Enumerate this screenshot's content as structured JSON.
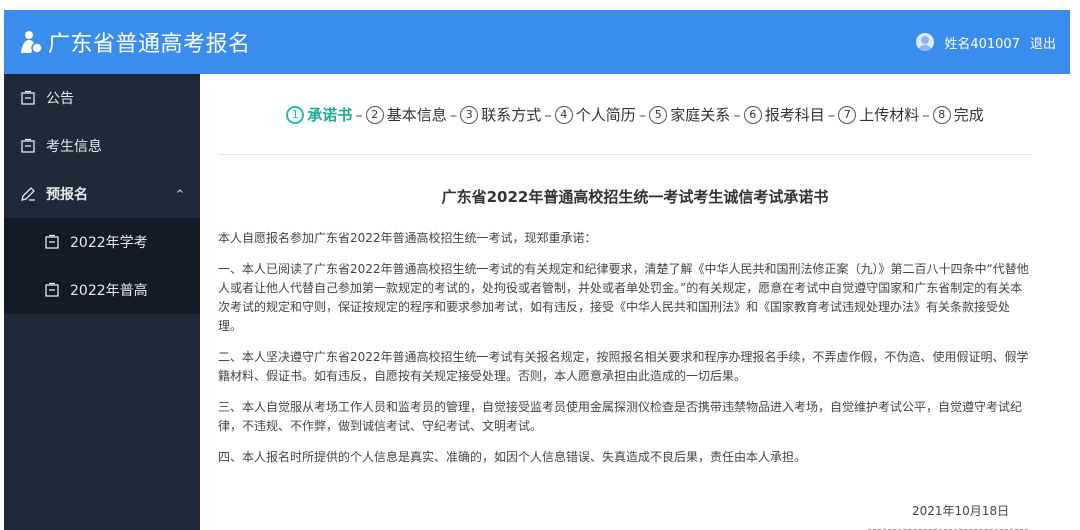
{
  "header": {
    "app_title": "广东省普通高考报名",
    "username": "姓名401007",
    "logout_label": "退出",
    "bar_color": "#3b8ded"
  },
  "sidebar": {
    "items": [
      {
        "label": "公告",
        "icon": "document-icon"
      },
      {
        "label": "考生信息",
        "icon": "document-icon"
      },
      {
        "label": "预报名",
        "icon": "edit-icon",
        "expanded": true
      }
    ],
    "subitems": [
      {
        "label": "2022年学考",
        "icon": "document-icon"
      },
      {
        "label": "2022年普高",
        "icon": "document-icon"
      }
    ],
    "background": "#1e2a38",
    "submenu_background": "#121b26"
  },
  "stepper": {
    "steps": [
      {
        "num": "1",
        "label": "承诺书",
        "active": true
      },
      {
        "num": "2",
        "label": "基本信息"
      },
      {
        "num": "3",
        "label": "联系方式"
      },
      {
        "num": "4",
        "label": "个人简历"
      },
      {
        "num": "5",
        "label": "家庭关系"
      },
      {
        "num": "6",
        "label": "报考科目"
      },
      {
        "num": "7",
        "label": "上传材料"
      },
      {
        "num": "8",
        "label": "完成"
      }
    ],
    "separator": "–",
    "active_color": "#20c0b0"
  },
  "document": {
    "title": "广东省2022年普通高校招生统一考试考生诚信考试承诺书",
    "intro": "本人自愿报名参加广东省2022年普通高校招生统一考试，现郑重承诺：",
    "paragraphs": [
      "一、本人已阅读了广东省2022年普通高校招生统一考试的有关规定和纪律要求，清楚了解《中华人民共和国刑法修正案（九）》第二百八十四条中“代替他人或者让他人代替自己参加第一款规定的考试的，处拘役或者管制，并处或者单处罚金。”的有关规定，愿意在考试中自觉遵守国家和广东省制定的有关本次考试的规定和守则，保证按规定的程序和要求参加考试，如有违反，接受《中华人民共和国刑法》和《国家教育考试违规处理办法》有关条款接受处理。",
      "二、本人坚决遵守广东省2022年普通高校招生统一考试有关报名规定，按照报名相关要求和程序办理报名手续，不弄虚作假，不伪造、使用假证明、假学籍材料、假证书。如有违反，自愿按有关规定接受处理。否则，本人愿意承担由此造成的一切后果。",
      "三、本人自觉服从考场工作人员和监考员的管理，自觉接受监考员使用金属探测仪检查是否携带违禁物品进入考场，自觉维护考试公平，自觉遵守考试纪律，不违规、不作弊，做到诚信考试、守纪考试、文明考试。",
      "四、本人报名时所提供的个人信息是真实、准确的，如因个人信息错误、失真造成不良后果，责任由本人承担。"
    ],
    "date": "2021年10月18日"
  }
}
